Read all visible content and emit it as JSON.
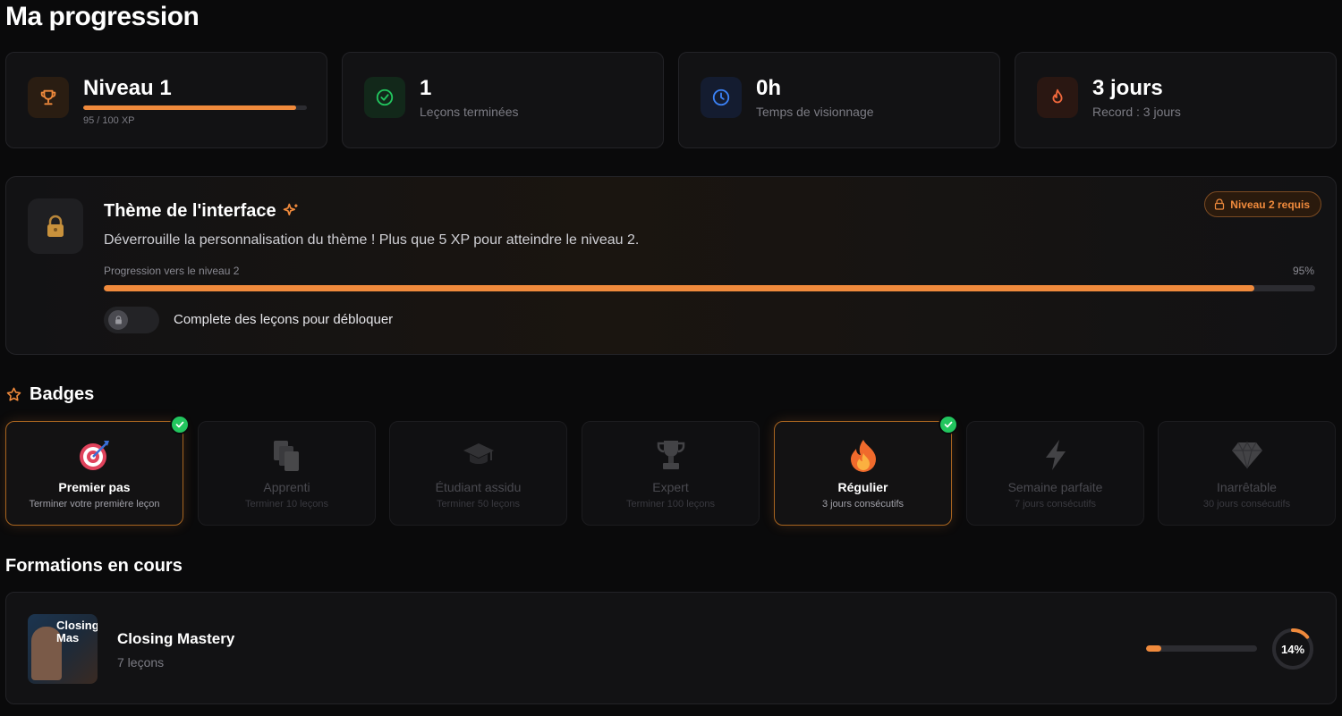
{
  "page": {
    "title": "Ma progression"
  },
  "stats": {
    "level": {
      "value": "Niveau 1",
      "xp_text": "95 / 100 XP",
      "xp_progress": 0.95,
      "icon": "trophy-icon"
    },
    "lessons": {
      "value": "1",
      "label": "Leçons terminées",
      "icon": "check-circle-icon"
    },
    "watch_time": {
      "value": "0h",
      "label": "Temps de visionnage",
      "icon": "clock-icon"
    },
    "streak": {
      "value": "3 jours",
      "label": "Record : 3 jours",
      "icon": "flame-icon"
    }
  },
  "theme": {
    "title": "Thème de l'interface",
    "description": "Déverrouille la personnalisation du thème ! Plus que 5 XP pour atteindre le niveau 2.",
    "badge_label": "Niveau 2 requis",
    "progress_label": "Progression vers le niveau 2",
    "progress_percent_label": "95%",
    "progress": 0.95,
    "toggle_label": "Complete des leçons pour débloquer"
  },
  "badges": {
    "heading": "Badges",
    "items": [
      {
        "name": "Premier pas",
        "desc": "Terminer votre première leçon",
        "unlocked": true,
        "icon": "target-icon"
      },
      {
        "name": "Apprenti",
        "desc": "Terminer 10 leçons",
        "unlocked": false,
        "icon": "books-icon"
      },
      {
        "name": "Étudiant assidu",
        "desc": "Terminer 50 leçons",
        "unlocked": false,
        "icon": "graduation-cap-icon"
      },
      {
        "name": "Expert",
        "desc": "Terminer 100 leçons",
        "unlocked": false,
        "icon": "trophy-icon"
      },
      {
        "name": "Régulier",
        "desc": "3 jours consécutifs",
        "unlocked": true,
        "icon": "fire-icon"
      },
      {
        "name": "Semaine parfaite",
        "desc": "7 jours consécutifs",
        "unlocked": false,
        "icon": "lightning-icon"
      },
      {
        "name": "Inarrêtable",
        "desc": "30 jours consécutifs",
        "unlocked": false,
        "icon": "diamond-icon"
      }
    ]
  },
  "courses": {
    "heading": "Formations en cours",
    "items": [
      {
        "title": "Closing Mastery",
        "subtitle": "7 leçons",
        "thumb_text": "Closing Mas",
        "progress": 0.14,
        "progress_label": "14%"
      }
    ]
  },
  "colors": {
    "accent": "#f08a3c",
    "success": "#22c55e",
    "background": "#0a0a0b",
    "card": "#121214"
  }
}
